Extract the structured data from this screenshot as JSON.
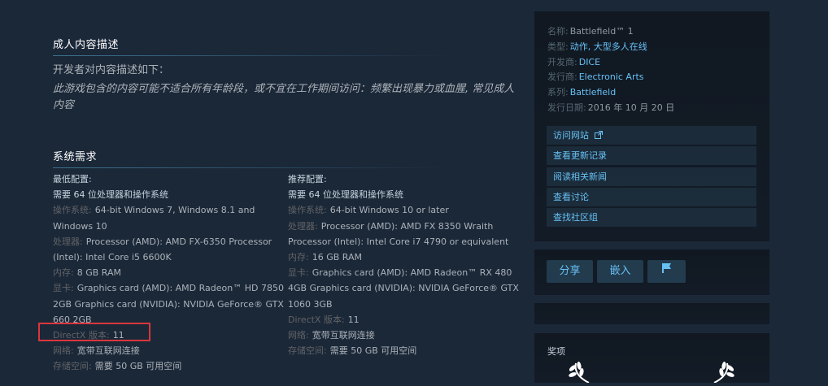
{
  "mature": {
    "title": "成人内容描述",
    "intro": "开发者对内容描述如下：",
    "text": "此游戏包含的内容可能不适合所有年龄段，或不宜在工作期间访问：频繁出现暴力或血腥, 常见成人内容"
  },
  "sysreq": {
    "title": "系统需求",
    "minimum": {
      "heading": "最低配置:",
      "note": "需要 64 位处理器和操作系统",
      "rows": [
        {
          "label": "操作系统:",
          "value": "64-bit Windows 7, Windows 8.1 and Windows 10"
        },
        {
          "label": "处理器:",
          "value": "Processor (AMD): AMD FX-6350 Processor (Intel): Intel Core i5 6600K"
        },
        {
          "label": "内存:",
          "value": "8 GB RAM"
        },
        {
          "label": "显卡:",
          "value": "Graphics card (AMD): AMD Radeon™ HD 7850 2GB Graphics card (NVIDIA): NVIDIA GeForce® GTX 660 2GB"
        },
        {
          "label": "DirectX 版本:",
          "value": "11"
        },
        {
          "label": "网络:",
          "value": "宽带互联网连接"
        },
        {
          "label": "存储空间:",
          "value": "需要 50 GB 可用空间"
        }
      ]
    },
    "recommended": {
      "heading": "推荐配置:",
      "note": "需要 64 位处理器和操作系统",
      "rows": [
        {
          "label": "操作系统:",
          "value": "64-bit Windows 10 or later"
        },
        {
          "label": "处理器:",
          "value": "Processor (AMD): AMD FX 8350 Wraith Processor (Intel): Intel Core i7 4790 or equivalent"
        },
        {
          "label": "内存:",
          "value": "16 GB RAM"
        },
        {
          "label": "显卡:",
          "value": "Graphics card (AMD): AMD Radeon™ RX 480 4GB Graphics card (NVIDIA): NVIDIA GeForce® GTX 1060 3GB"
        },
        {
          "label": "DirectX 版本:",
          "value": "11"
        },
        {
          "label": "网络:",
          "value": "宽带互联网连接"
        },
        {
          "label": "存储空间:",
          "value": "需要 50 GB 可用空间"
        }
      ]
    }
  },
  "details": {
    "name_label": "名称:",
    "name": "Battlefield™ 1",
    "genre_label": "类型:",
    "genre": "动作, 大型多人在线",
    "dev_label": "开发商:",
    "dev": "DICE",
    "pub_label": "发行商:",
    "pub": "Electronic Arts",
    "series_label": "系列:",
    "series": "Battlefield",
    "date_label": "发行日期:",
    "date": "2016 年 10 月 20 日"
  },
  "links": [
    "访问网站",
    "查看更新记录",
    "阅读相关新闻",
    "查看讨论",
    "查找社区组"
  ],
  "actions": {
    "share": "分享",
    "embed": "嵌入"
  },
  "awards": {
    "title": "奖项"
  },
  "colors": {
    "accent": "#67c1f5",
    "background": "#1b2838",
    "highlight": "#d9363e"
  }
}
